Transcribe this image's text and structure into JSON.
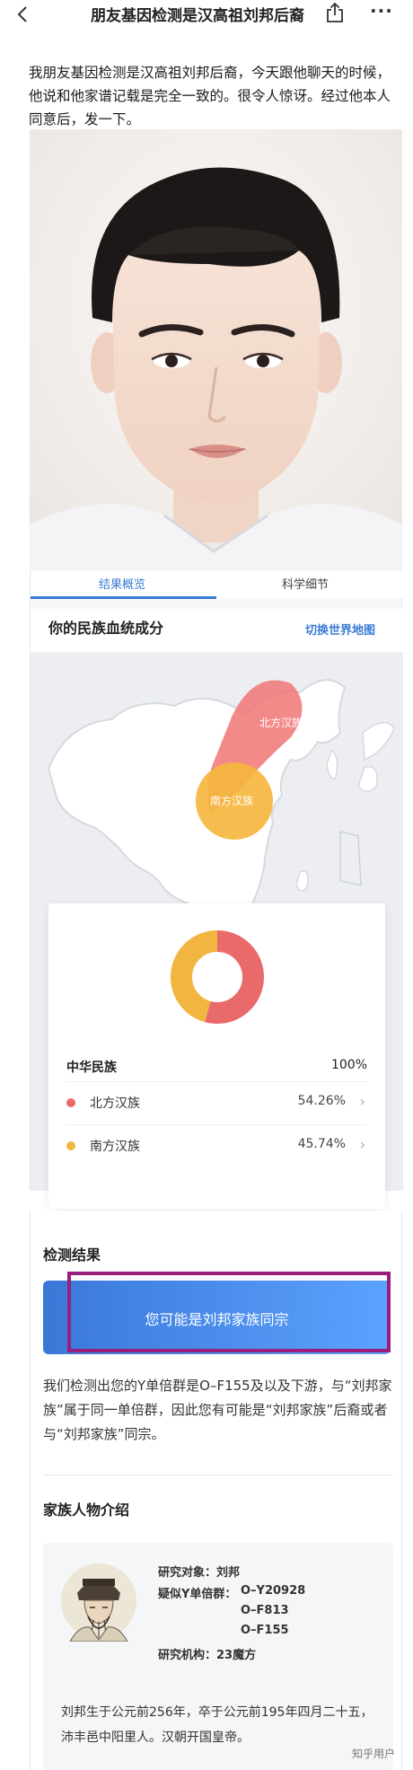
{
  "header": {
    "title": "朋友基因检测是汉高祖刘邦后裔",
    "back_icon": "chevron-left-icon",
    "share_icon": "share-icon",
    "more_icon": "more-icon",
    "more_glyph": "···"
  },
  "post": {
    "text": "我朋友基因检测是汉高祖刘邦后裔，今天跟他聊天的时候，他说和他家谱记载是完全一致的。很令人惊讶。经过他本人同意后，发一下。"
  },
  "report": {
    "tabs": [
      {
        "label": "结果概览",
        "active": true
      },
      {
        "label": "科学细节",
        "active": false
      }
    ],
    "ancestry_title": "你的民族血统成分",
    "switch_map_label": "切换世界地图",
    "map_regions": [
      {
        "label": "北方汉族",
        "color": "#f06a6a"
      },
      {
        "label": "南方汉族",
        "color": "#f5b63e"
      }
    ],
    "total": {
      "label": "中华民族",
      "percent": "100%"
    },
    "populations": [
      {
        "name": "北方汉族",
        "percent": "54.26%",
        "value": 54.26,
        "color": "#e96a6a"
      },
      {
        "name": "南方汉族",
        "percent": "45.74%",
        "value": 45.74,
        "color": "#f2b640"
      }
    ]
  },
  "results": {
    "title": "检测结果",
    "banner": "您可能是刘邦家族同宗",
    "description": "我们检测出您的Y单倍群是O–F155及以及下游，与“刘邦家族”属于同一单倍群，因此您有可能是“刘邦家族”后裔或者与“刘邦家族”同宗。",
    "family_title": "家族人物介绍",
    "figure": {
      "subject_label": "研究对象：",
      "subject": "刘邦",
      "haplogroup_label": "疑似Y单倍群：",
      "haplogroups": [
        "O–Y20928",
        "O–F813",
        "O–F155"
      ],
      "institution_label": "研究机构：",
      "institution": "23魔方",
      "bio": "刘邦生于公元前256年，卒于公元前195年四月二十五，沛丰邑中阳里人。汉朝开国皇帝。"
    }
  },
  "watermark": "知乎用户"
}
